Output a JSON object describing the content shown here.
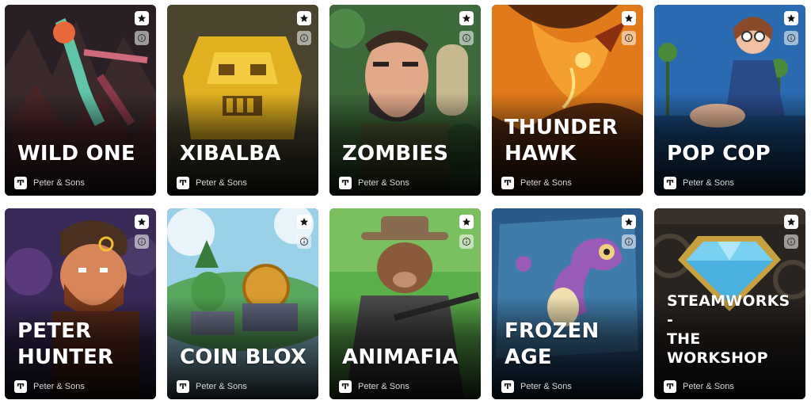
{
  "games": [
    {
      "title": "WILD ONE",
      "provider": "Peter & Sons",
      "art": "wild-one"
    },
    {
      "title": "XIBALBA",
      "provider": "Peter & Sons",
      "art": "xibalba"
    },
    {
      "title": "ZOMBIES",
      "provider": "Peter & Sons",
      "art": "zombies"
    },
    {
      "title": "THUNDER\nHAWK",
      "provider": "Peter & Sons",
      "art": "thunder-hawk"
    },
    {
      "title": "POP COP",
      "provider": "Peter & Sons",
      "art": "pop-cop"
    },
    {
      "title": "PETER\nHUNTER",
      "provider": "Peter & Sons",
      "art": "peter-hunter"
    },
    {
      "title": "COIN BLOX",
      "provider": "Peter & Sons",
      "art": "coin-blox"
    },
    {
      "title": "ANIMAFIA",
      "provider": "Peter & Sons",
      "art": "animafia"
    },
    {
      "title": "FROZEN AGE",
      "provider": "Peter & Sons",
      "art": "frozen-age"
    },
    {
      "title": "STEAMWORKS -\nTHE WORKSHOP",
      "provider": "Peter & Sons",
      "art": "steamworks"
    }
  ],
  "icons": {
    "favorite": "star-icon",
    "info": "info-icon",
    "provider_logo": "peter-and-sons-logo-icon"
  }
}
